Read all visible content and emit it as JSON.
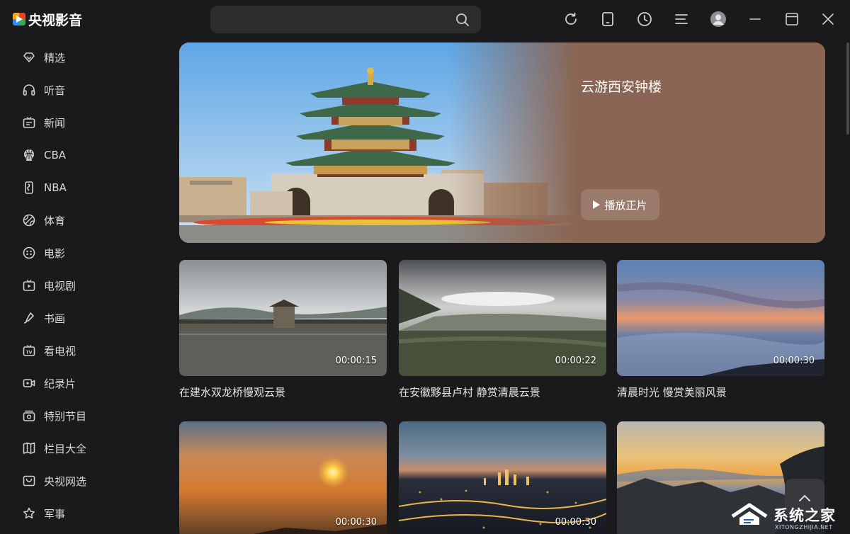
{
  "app": {
    "title": "央视影音",
    "brand_colors": [
      "#f5a623",
      "#e8412c",
      "#2d8cf0",
      "#2bb24c"
    ]
  },
  "search": {
    "placeholder": "",
    "value": "",
    "icon": "search-icon"
  },
  "toolbar": {
    "icons": [
      "refresh-icon",
      "mobile-icon",
      "history-icon",
      "menu-icon",
      "avatar-icon",
      "minimize-icon",
      "maximize-icon",
      "close-icon"
    ]
  },
  "sidebar": {
    "items": [
      {
        "label": "精选",
        "icon": "featured-icon"
      },
      {
        "label": "听音",
        "icon": "headphones-icon"
      },
      {
        "label": "新闻",
        "icon": "news-icon"
      },
      {
        "label": "CBA",
        "icon": "cba-icon"
      },
      {
        "label": "NBA",
        "icon": "nba-icon"
      },
      {
        "label": "体育",
        "icon": "sports-icon"
      },
      {
        "label": "电影",
        "icon": "movie-icon"
      },
      {
        "label": "电视剧",
        "icon": "tv-series-icon"
      },
      {
        "label": "书画",
        "icon": "painting-icon"
      },
      {
        "label": "看电视",
        "icon": "tv-icon"
      },
      {
        "label": "纪录片",
        "icon": "documentary-icon"
      },
      {
        "label": "特别节目",
        "icon": "special-icon"
      },
      {
        "label": "栏目大全",
        "icon": "columns-icon"
      },
      {
        "label": "央视网选",
        "icon": "shop-icon"
      },
      {
        "label": "军事",
        "icon": "military-icon"
      }
    ]
  },
  "hero": {
    "title": "云游西安钟楼",
    "play_label": "播放正片",
    "bg_color": "#8a6553"
  },
  "videos": [
    {
      "title": "在建水双龙桥慢观云景",
      "duration": "00:00:15"
    },
    {
      "title": "在安徽黟县卢村 静赏清晨云景",
      "duration": "00:00:22"
    },
    {
      "title": "清晨时光 慢赏美丽风景",
      "duration": "00:00:30"
    },
    {
      "title": "",
      "duration": "00:00:30"
    },
    {
      "title": "",
      "duration": "00:00:30"
    },
    {
      "title": "",
      "duration": ""
    }
  ],
  "watermark": {
    "text": "系统之家",
    "sub": "XITONGZHIJIA.NET"
  }
}
